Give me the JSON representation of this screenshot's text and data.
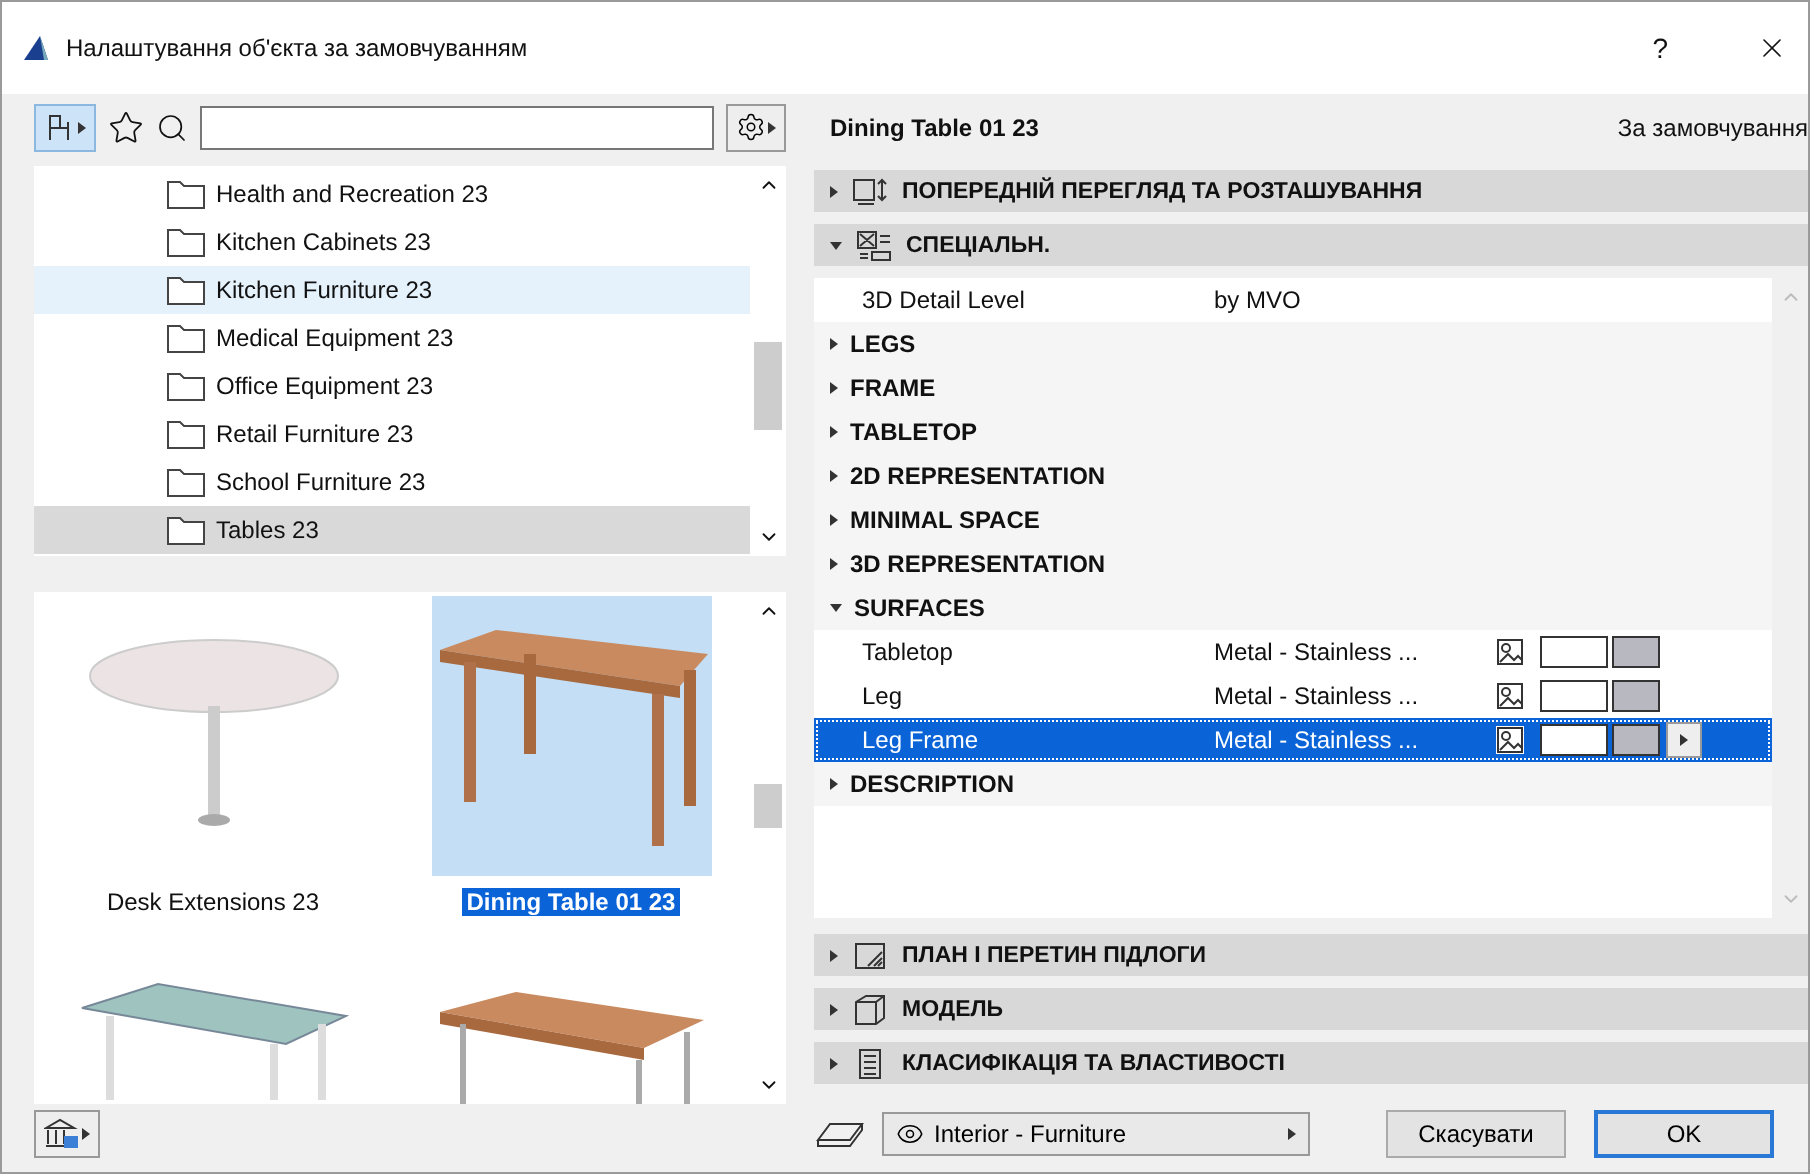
{
  "window": {
    "title": "Налаштування об'єкта за замовчуванням",
    "help": "?"
  },
  "library": {
    "folders": [
      {
        "name": "Health and Recreation 23",
        "selected": false,
        "hovered": false
      },
      {
        "name": "Kitchen Cabinets 23",
        "selected": false,
        "hovered": false
      },
      {
        "name": "Kitchen Furniture 23",
        "selected": false,
        "hovered": true
      },
      {
        "name": "Medical Equipment 23",
        "selected": false,
        "hovered": false
      },
      {
        "name": "Office Equipment 23",
        "selected": false,
        "hovered": false
      },
      {
        "name": "Retail Furniture 23",
        "selected": false,
        "hovered": false
      },
      {
        "name": "School Furniture 23",
        "selected": false,
        "hovered": false
      },
      {
        "name": "Tables 23",
        "selected": true,
        "hovered": false
      }
    ],
    "objects": [
      {
        "kind": "pedestal",
        "name": "Desk Extensions 23",
        "selected": false
      },
      {
        "kind": "wood",
        "name": "Dining Table 01 23",
        "selected": true
      },
      {
        "kind": "glass",
        "selected": false
      },
      {
        "kind": "wood-low",
        "selected": false
      }
    ]
  },
  "settings": {
    "object_name": "Dining Table 01 23",
    "default_label": "За замовчування",
    "sections_top": [
      {
        "kind": "preview",
        "title": "ПОПЕРЕДНІЙ ПЕРЕГЛЯД ТА РОЗТАШУВАННЯ",
        "expanded": false
      },
      {
        "kind": "params",
        "title": "СПЕЦІАЛЬН.",
        "expanded": true
      }
    ],
    "parameters": [
      {
        "kind": "value",
        "label": "3D Detail Level",
        "value": "by MVO"
      },
      {
        "kind": "group",
        "label": "LEGS",
        "expanded": false
      },
      {
        "kind": "group",
        "label": "FRAME",
        "expanded": false
      },
      {
        "kind": "group",
        "label": "TABLETOP",
        "expanded": false
      },
      {
        "kind": "group",
        "label": "2D REPRESENTATION",
        "expanded": false
      },
      {
        "kind": "group",
        "label": "MINIMAL SPACE",
        "expanded": false
      },
      {
        "kind": "group",
        "label": "3D REPRESENTATION",
        "expanded": false
      },
      {
        "kind": "group",
        "label": "SURFACES",
        "expanded": true,
        "children": [
          {
            "kind": "surface",
            "label": "Tabletop",
            "value": "Metal - Stainless ...",
            "selected": false
          },
          {
            "kind": "surface",
            "label": "Leg",
            "value": "Metal - Stainless ...",
            "selected": false
          },
          {
            "kind": "surface",
            "label": "Leg Frame",
            "value": "Metal - Stainless ...",
            "selected": true
          }
        ]
      },
      {
        "kind": "group",
        "label": "DESCRIPTION",
        "expanded": false
      }
    ],
    "sections_bottom": [
      {
        "kind": "plan",
        "title": "ПЛАН І ПЕРЕТИН ПІДЛОГИ",
        "expanded": false
      },
      {
        "kind": "model",
        "title": "МОДЕЛЬ",
        "expanded": false
      },
      {
        "kind": "classification",
        "title": "КЛАСИФІКАЦІЯ ТА ВЛАСТИВОСТІ",
        "expanded": false
      }
    ]
  },
  "footer": {
    "layer": "Interior - Furniture",
    "cancel": "Скасувати",
    "ok": "OK"
  }
}
